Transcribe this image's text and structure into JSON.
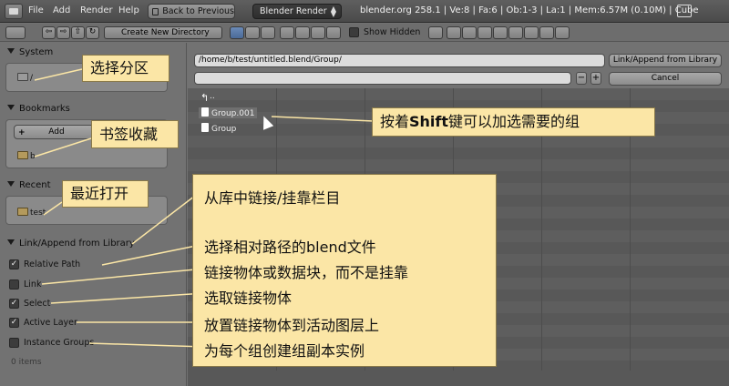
{
  "topbar": {
    "menus": [
      "File",
      "Add",
      "Render",
      "Help"
    ],
    "back_button": "Back to Previous",
    "render_engine": "Blender Render",
    "stats": "blender.org 258.1 | Ve:8 | Fa:6 | Ob:1-3 | La:1 | Mem:6.57M (0.10M) | Cube"
  },
  "file_toolbar": {
    "create_dir_label": "Create New Directory",
    "show_hidden_label": "Show Hidden"
  },
  "sidebar": {
    "system": {
      "title": "System",
      "entry": "/"
    },
    "bookmarks": {
      "title": "Bookmarks",
      "add_label": "Add",
      "entry": "b"
    },
    "recent": {
      "title": "Recent",
      "entry": "test"
    },
    "link_append": {
      "title": "Link/Append from Library",
      "options": [
        {
          "label": "Relative Path",
          "checked": true
        },
        {
          "label": "Link",
          "checked": false
        },
        {
          "label": "Select",
          "checked": true
        },
        {
          "label": "Active Layer",
          "checked": true
        },
        {
          "label": "Instance Groups",
          "checked": false
        }
      ]
    },
    "items_count": "0 items"
  },
  "header": {
    "path": "/home/b/test/untitled.blend/Group/",
    "filename": "",
    "link_append_button": "Link/Append from Library",
    "cancel_button": "Cancel"
  },
  "files": [
    {
      "name": ".."
    },
    {
      "name": "Group.001"
    },
    {
      "name": "Group"
    }
  ],
  "annotations": {
    "system": "选择分区",
    "bookmarks": "书签收藏",
    "recent": "最近打开",
    "shift_tip_pre": "按着",
    "shift_tip_bold": "Shift",
    "shift_tip_post": "键可以加选需要的组",
    "lines": [
      "从库中链接/挂靠栏目",
      "选择相对路径的blend文件",
      "链接物体或数据块，而不是挂靠",
      "选取链接物体",
      "放置链接物体到活动图层上",
      "为每个组创建组副本实例"
    ]
  }
}
